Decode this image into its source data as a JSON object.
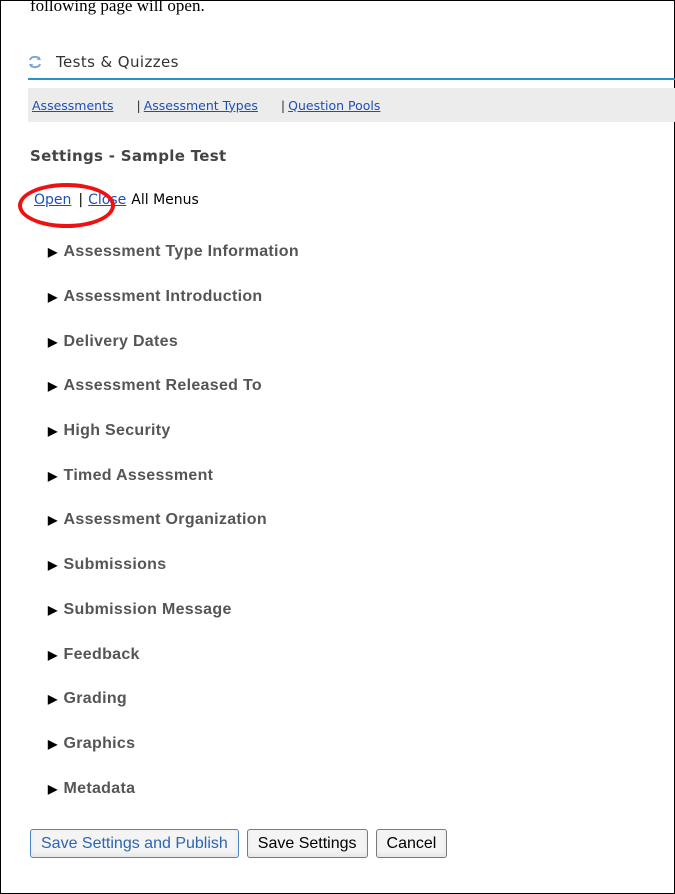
{
  "top_fragment": "following page will open.",
  "tool": {
    "title": "Tests & Quizzes",
    "icon": "refresh-arrows-icon"
  },
  "nav": {
    "assessments": "Assessments",
    "separator": "|",
    "assessment_types": "Assessment Types",
    "question_pools": "Question Pools"
  },
  "page": {
    "title": "Settings - Sample Test"
  },
  "toggle": {
    "open": "Open",
    "pipe": "|",
    "close": "Close",
    "tail": "All Menus"
  },
  "sections": [
    "Assessment Type Information",
    "Assessment Introduction",
    "Delivery Dates",
    "Assessment Released To",
    "High Security",
    "Timed Assessment",
    "Assessment Organization",
    "Submissions",
    "Submission Message",
    "Feedback",
    "Grading",
    "Graphics",
    "Metadata"
  ],
  "section_arrow": "▶",
  "buttons": {
    "save_publish": "Save Settings and Publish",
    "save": "Save Settings",
    "cancel": "Cancel"
  },
  "colors": {
    "accent_line": "#2a93c8",
    "link": "#1b4fb8",
    "annotation_circle": "#e11111"
  }
}
